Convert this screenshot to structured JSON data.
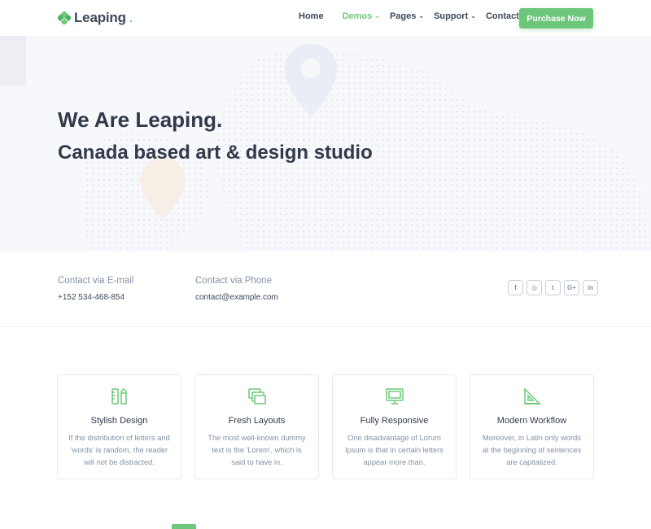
{
  "brand": {
    "name": "Leaping",
    "dot": ".",
    "accent": "#6dc77a"
  },
  "nav": {
    "items": [
      {
        "label": "Home",
        "has_dropdown": false,
        "active": false
      },
      {
        "label": "Demos",
        "has_dropdown": true,
        "active": true
      },
      {
        "label": "Pages",
        "has_dropdown": true,
        "active": false
      },
      {
        "label": "Support",
        "has_dropdown": true,
        "active": false
      },
      {
        "label": "Contact",
        "has_dropdown": false,
        "active": false
      }
    ],
    "cta_label": "Purchase Now"
  },
  "hero": {
    "title": "We Are Leaping.",
    "subtitle": "Canada based art & design studio"
  },
  "contact": {
    "email": {
      "label": "Contact via E-mail",
      "value": "+152 534-468-854"
    },
    "phone": {
      "label": "Contact via Phone",
      "value": "contact@example.com"
    },
    "socials": [
      {
        "icon": "facebook-icon",
        "glyph": "f"
      },
      {
        "icon": "instagram-icon",
        "glyph": "◎"
      },
      {
        "icon": "twitter-icon",
        "glyph": "t"
      },
      {
        "icon": "google-plus-icon",
        "glyph": "G+"
      },
      {
        "icon": "linkedin-icon",
        "glyph": "in"
      }
    ]
  },
  "features": [
    {
      "icon": "ruler-pencil-icon",
      "title": "Stylish Design",
      "text": "If the distribution of letters and 'words' is random, the reader will not be distracted."
    },
    {
      "icon": "layers-icon",
      "title": "Fresh Layouts",
      "text": "The most well-known dummy text is the 'Lorem', which is said to have in."
    },
    {
      "icon": "monitor-icon",
      "title": "Fully Responsive",
      "text": "One disadvantage of Lorum Ipsum is that in certain letters appear more than."
    },
    {
      "icon": "set-square-icon",
      "title": "Modern Workflow",
      "text": "Moreover, in Latin only words at the beginning of sentences are capitalized."
    }
  ]
}
